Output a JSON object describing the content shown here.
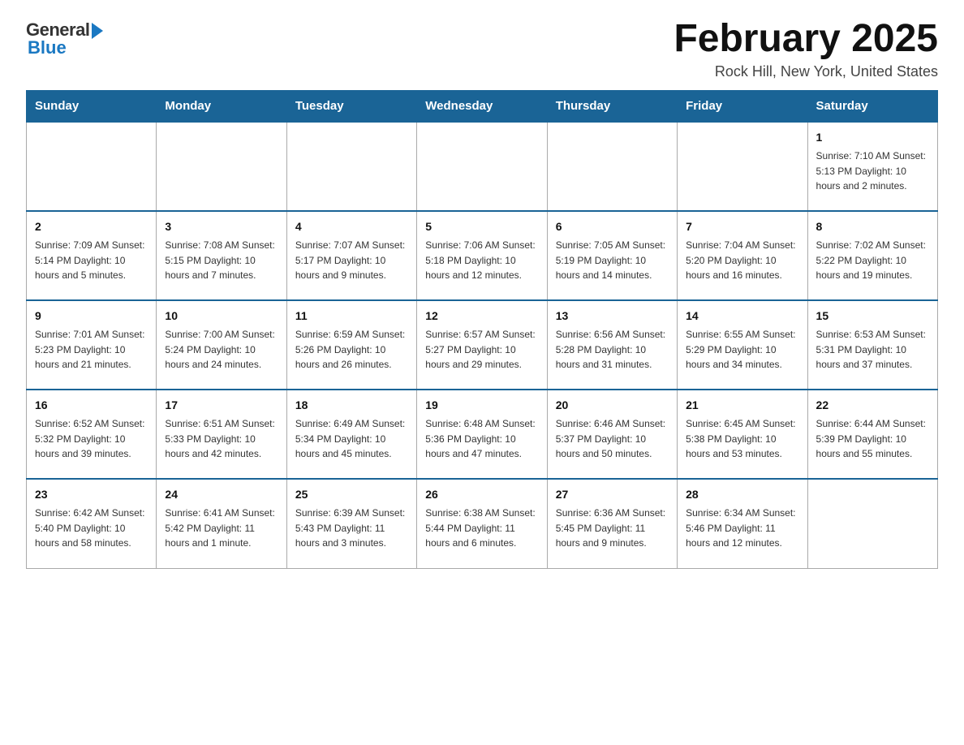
{
  "logo": {
    "general": "General",
    "blue": "Blue"
  },
  "title": "February 2025",
  "location": "Rock Hill, New York, United States",
  "weekdays": [
    "Sunday",
    "Monday",
    "Tuesday",
    "Wednesday",
    "Thursday",
    "Friday",
    "Saturday"
  ],
  "weeks": [
    [
      {
        "day": "",
        "info": ""
      },
      {
        "day": "",
        "info": ""
      },
      {
        "day": "",
        "info": ""
      },
      {
        "day": "",
        "info": ""
      },
      {
        "day": "",
        "info": ""
      },
      {
        "day": "",
        "info": ""
      },
      {
        "day": "1",
        "info": "Sunrise: 7:10 AM\nSunset: 5:13 PM\nDaylight: 10 hours\nand 2 minutes."
      }
    ],
    [
      {
        "day": "2",
        "info": "Sunrise: 7:09 AM\nSunset: 5:14 PM\nDaylight: 10 hours\nand 5 minutes."
      },
      {
        "day": "3",
        "info": "Sunrise: 7:08 AM\nSunset: 5:15 PM\nDaylight: 10 hours\nand 7 minutes."
      },
      {
        "day": "4",
        "info": "Sunrise: 7:07 AM\nSunset: 5:17 PM\nDaylight: 10 hours\nand 9 minutes."
      },
      {
        "day": "5",
        "info": "Sunrise: 7:06 AM\nSunset: 5:18 PM\nDaylight: 10 hours\nand 12 minutes."
      },
      {
        "day": "6",
        "info": "Sunrise: 7:05 AM\nSunset: 5:19 PM\nDaylight: 10 hours\nand 14 minutes."
      },
      {
        "day": "7",
        "info": "Sunrise: 7:04 AM\nSunset: 5:20 PM\nDaylight: 10 hours\nand 16 minutes."
      },
      {
        "day": "8",
        "info": "Sunrise: 7:02 AM\nSunset: 5:22 PM\nDaylight: 10 hours\nand 19 minutes."
      }
    ],
    [
      {
        "day": "9",
        "info": "Sunrise: 7:01 AM\nSunset: 5:23 PM\nDaylight: 10 hours\nand 21 minutes."
      },
      {
        "day": "10",
        "info": "Sunrise: 7:00 AM\nSunset: 5:24 PM\nDaylight: 10 hours\nand 24 minutes."
      },
      {
        "day": "11",
        "info": "Sunrise: 6:59 AM\nSunset: 5:26 PM\nDaylight: 10 hours\nand 26 minutes."
      },
      {
        "day": "12",
        "info": "Sunrise: 6:57 AM\nSunset: 5:27 PM\nDaylight: 10 hours\nand 29 minutes."
      },
      {
        "day": "13",
        "info": "Sunrise: 6:56 AM\nSunset: 5:28 PM\nDaylight: 10 hours\nand 31 minutes."
      },
      {
        "day": "14",
        "info": "Sunrise: 6:55 AM\nSunset: 5:29 PM\nDaylight: 10 hours\nand 34 minutes."
      },
      {
        "day": "15",
        "info": "Sunrise: 6:53 AM\nSunset: 5:31 PM\nDaylight: 10 hours\nand 37 minutes."
      }
    ],
    [
      {
        "day": "16",
        "info": "Sunrise: 6:52 AM\nSunset: 5:32 PM\nDaylight: 10 hours\nand 39 minutes."
      },
      {
        "day": "17",
        "info": "Sunrise: 6:51 AM\nSunset: 5:33 PM\nDaylight: 10 hours\nand 42 minutes."
      },
      {
        "day": "18",
        "info": "Sunrise: 6:49 AM\nSunset: 5:34 PM\nDaylight: 10 hours\nand 45 minutes."
      },
      {
        "day": "19",
        "info": "Sunrise: 6:48 AM\nSunset: 5:36 PM\nDaylight: 10 hours\nand 47 minutes."
      },
      {
        "day": "20",
        "info": "Sunrise: 6:46 AM\nSunset: 5:37 PM\nDaylight: 10 hours\nand 50 minutes."
      },
      {
        "day": "21",
        "info": "Sunrise: 6:45 AM\nSunset: 5:38 PM\nDaylight: 10 hours\nand 53 minutes."
      },
      {
        "day": "22",
        "info": "Sunrise: 6:44 AM\nSunset: 5:39 PM\nDaylight: 10 hours\nand 55 minutes."
      }
    ],
    [
      {
        "day": "23",
        "info": "Sunrise: 6:42 AM\nSunset: 5:40 PM\nDaylight: 10 hours\nand 58 minutes."
      },
      {
        "day": "24",
        "info": "Sunrise: 6:41 AM\nSunset: 5:42 PM\nDaylight: 11 hours\nand 1 minute."
      },
      {
        "day": "25",
        "info": "Sunrise: 6:39 AM\nSunset: 5:43 PM\nDaylight: 11 hours\nand 3 minutes."
      },
      {
        "day": "26",
        "info": "Sunrise: 6:38 AM\nSunset: 5:44 PM\nDaylight: 11 hours\nand 6 minutes."
      },
      {
        "day": "27",
        "info": "Sunrise: 6:36 AM\nSunset: 5:45 PM\nDaylight: 11 hours\nand 9 minutes."
      },
      {
        "day": "28",
        "info": "Sunrise: 6:34 AM\nSunset: 5:46 PM\nDaylight: 11 hours\nand 12 minutes."
      },
      {
        "day": "",
        "info": ""
      }
    ]
  ]
}
